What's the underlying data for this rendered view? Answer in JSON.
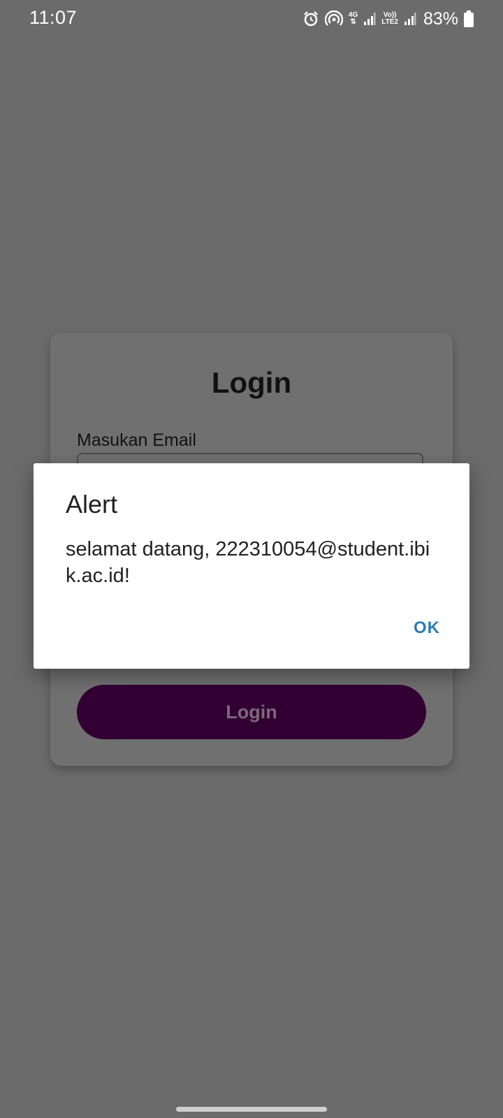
{
  "status_bar": {
    "time": "11:07",
    "network_label_top": "4G",
    "volte_label_top": "Vo))",
    "volte_label_bottom": "LTE2",
    "battery_percent": "83%",
    "icons": [
      "alarm-icon",
      "hotspot-icon",
      "signal-icon",
      "signal-icon",
      "battery-icon"
    ]
  },
  "login_card": {
    "title": "Login",
    "email_label": "Masukan Email",
    "email_value": "",
    "button_label": "Login"
  },
  "alert": {
    "title": "Alert",
    "message": "selamat datang, 222310054@student.ibik.ac.id!",
    "ok_label": "OK",
    "ok_color": "#2c7bb6"
  },
  "colors": {
    "scrim": "#6b6b6b",
    "login_button": "#330033",
    "dialog_background": "#ffffff"
  }
}
